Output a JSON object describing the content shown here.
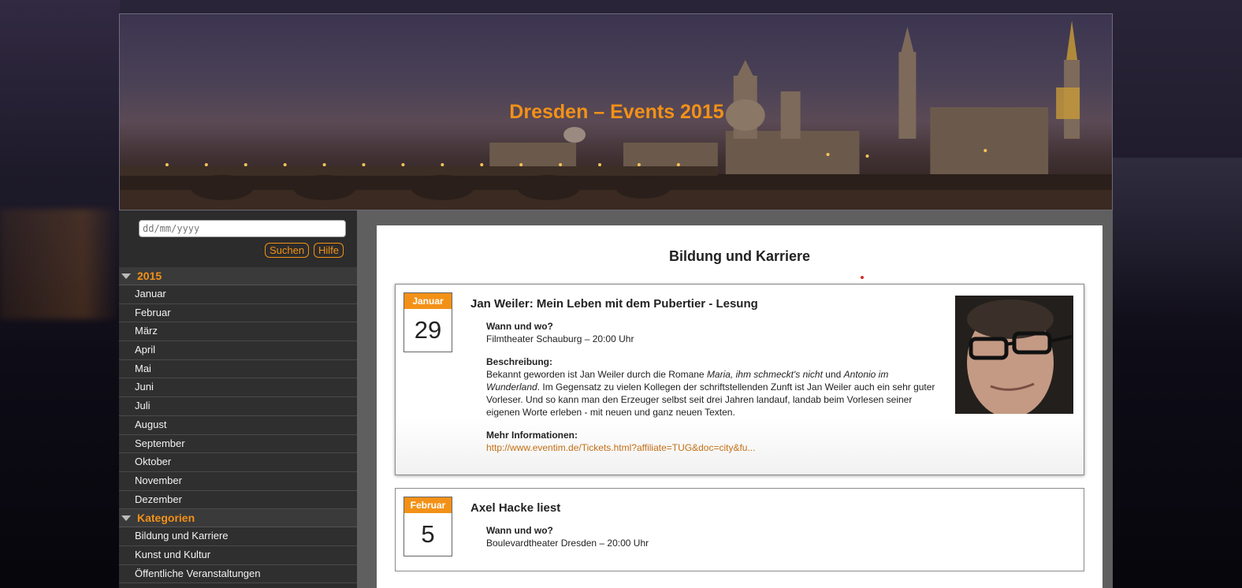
{
  "header": {
    "title": "Dresden – Events 2015"
  },
  "search": {
    "placeholder": "dd/mm/yyyy",
    "search_label": "Suchen",
    "help_label": "Hilfe"
  },
  "sidebar": {
    "year_heading": "2015",
    "months": [
      "Januar",
      "Februar",
      "März",
      "April",
      "Mai",
      "Juni",
      "Juli",
      "August",
      "September",
      "Oktober",
      "November",
      "Dezember"
    ],
    "categories_heading": "Kategorien",
    "categories": [
      "Bildung und Karriere",
      "Kunst und Kultur",
      "Öffentliche Veranstaltungen"
    ]
  },
  "main": {
    "section_title": "Bildung und Karriere",
    "events": [
      {
        "month": "Januar",
        "day": "29",
        "title": "Jan Weiler: Mein Leben mit dem Pubertier - Lesung",
        "where_label": "Wann und wo?",
        "where": "Filmtheater Schauburg – 20:00 Uhr",
        "desc_label": "Beschreibung:",
        "desc_1": "Bekannt geworden ist Jan Weiler durch die Romane ",
        "desc_italic_1": "Maria, ihm schmeckt's nicht",
        "desc_2": " und ",
        "desc_italic_2": "Antonio im Wunderland",
        "desc_3": ". Im Gegensatz zu vielen Kollegen der schriftstellenden Zunft ist Jan Weiler auch ein sehr guter Vorleser. Und so kann man den Erzeuger selbst seit drei Jahren landauf, landab beim Vorlesen seiner eigenen Worte erleben - mit neuen und ganz neuen Texten.",
        "more_label": "Mehr Informationen:",
        "more_link": "http://www.eventim.de/Tickets.html?affiliate=TUG&doc=city&fu..."
      },
      {
        "month": "Februar",
        "day": "5",
        "title": "Axel Hacke liest",
        "where_label": "Wann und wo?",
        "where": "Boulevardtheater Dresden – 20:00 Uhr"
      }
    ]
  },
  "colors": {
    "accent": "#f39117",
    "link": "#c47016",
    "sidebar_bg": "#2c2c2c"
  },
  "icons": {
    "expand": "triangle-down-icon"
  }
}
